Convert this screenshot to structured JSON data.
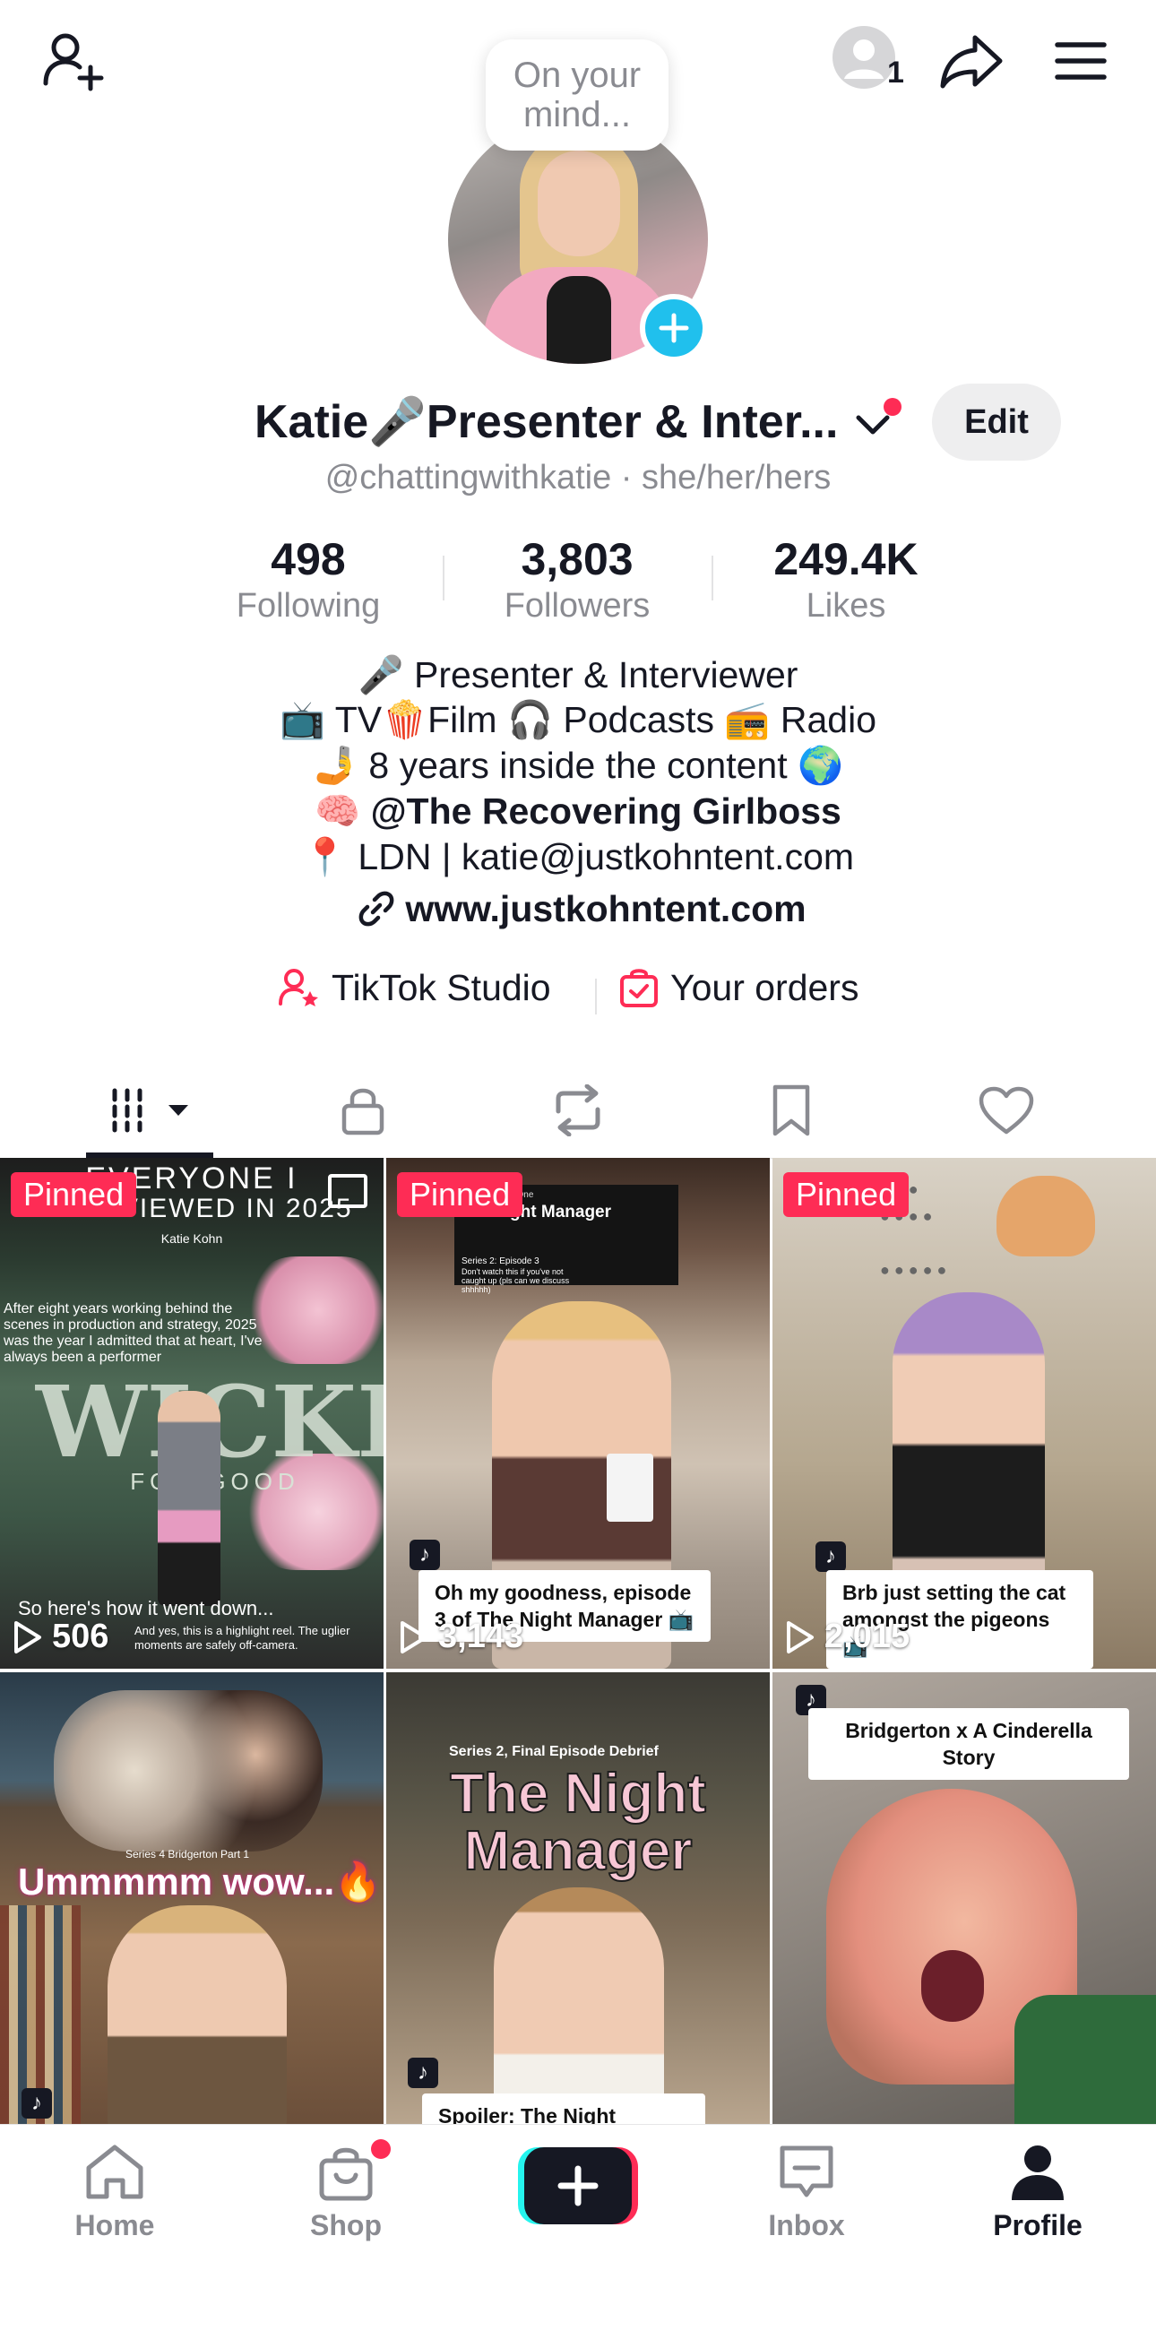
{
  "header": {
    "add_friend_icon": "person-plus-icon",
    "notif_count": "1",
    "share_icon": "share-arrow-icon",
    "menu_icon": "hamburger-icon"
  },
  "profile": {
    "mind_bubble_line1": "On your",
    "mind_bubble_line2": "mind...",
    "name": "Katie🎤Presenter & Inter...",
    "edit_label": "Edit",
    "handle": "@chattingwithkatie · she/her/hers"
  },
  "stats": [
    {
      "value": "498",
      "label": "Following"
    },
    {
      "value": "3,803",
      "label": "Followers"
    },
    {
      "value": "249.4K",
      "label": "Likes"
    }
  ],
  "bio": {
    "line1": "🎤 Presenter & Interviewer",
    "line2": "📺 TV🍿Film 🎧 Podcasts 📻 Radio",
    "line3": "🤳 8 years inside the content 🌍",
    "line4": "🧠 @The Recovering Girlboss",
    "line5": "📍 LDN | katie@justkohntent.com",
    "link": "www.justkohntent.com"
  },
  "tools": {
    "studio": "TikTok Studio",
    "orders": "Your orders"
  },
  "videos": [
    {
      "pinned": "Pinned",
      "views": "506",
      "title1": "EVERYONE I",
      "title2": "INTERVIEWED IN 2025",
      "sub": "Katie Kohn",
      "big": "WICKED",
      "small": "FOR GOOD",
      "body": "After eight years working behind the scenes in production and strategy, 2025 was the year I admitted that at heart, I've always been a performer",
      "footer1": "So here's how it went down...",
      "footer2": "And yes, this is a highlight reel. The uglier moments are safely off-camera."
    },
    {
      "pinned": "Pinned",
      "views": "3,143",
      "tag": "Drama | BBC One",
      "title": "The Night Manager",
      "sub": "Series 2: Episode 3",
      "note": "Don't watch this if you've not caught up (pls can we discuss shhhhh)",
      "caption": "Oh my goodness, episode 3 of The Night Manager 📺"
    },
    {
      "pinned": "Pinned",
      "views": "2,015",
      "caption": "Brb just setting the cat amongst the pigeons 📺"
    },
    {
      "top": "Series 4 Bridgerton Part 1",
      "headline": "Ummmmm wow...🔥"
    },
    {
      "top": "Series 2, Final Episode Debrief",
      "headline": "The Night Manager",
      "caption": "Spoiler: The Night Manager"
    },
    {
      "caption": "Bridgerton x A Cinderella Story"
    }
  ],
  "nav": {
    "home": "Home",
    "shop": "Shop",
    "inbox": "Inbox",
    "profile": "Profile"
  },
  "colors": {
    "accent": "#fe2c55",
    "badge_blue": "#20c0ed",
    "muted": "#8a8b91"
  }
}
